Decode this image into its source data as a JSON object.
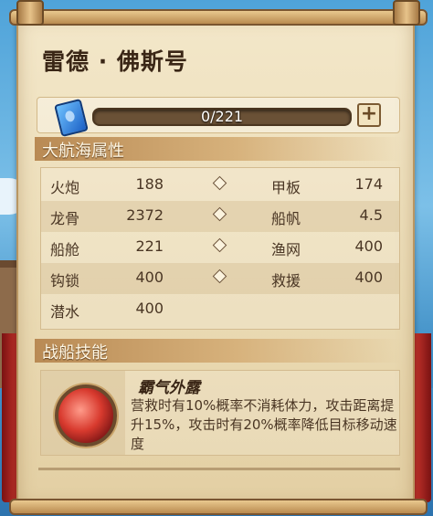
{
  "ship": {
    "name": "雷德 · 佛斯号"
  },
  "progress": {
    "label": "0/221",
    "fraction": 0.0
  },
  "attributes": {
    "header": "大航海属性",
    "rows": [
      {
        "left_label": "火炮",
        "left_value": "188",
        "right_label": "甲板",
        "right_value": "174"
      },
      {
        "left_label": "龙骨",
        "left_value": "2372",
        "right_label": "船帆",
        "right_value": "4.5"
      },
      {
        "left_label": "船舱",
        "left_value": "221",
        "right_label": "渔网",
        "right_value": "400"
      },
      {
        "left_label": "钩锁",
        "left_value": "400",
        "right_label": "救援",
        "right_value": "400"
      },
      {
        "left_label": "潜水",
        "left_value": "400"
      }
    ]
  },
  "skills": {
    "header": "战船技能",
    "name": "霸气外露",
    "description": "营救时有10%概率不消耗体力，攻击距离提升15%，攻击时有20%概率降低目标移动速度"
  },
  "colors": {
    "accent": "#e0a347",
    "parchment": "#eadab3",
    "curtain": "#c0322a"
  }
}
